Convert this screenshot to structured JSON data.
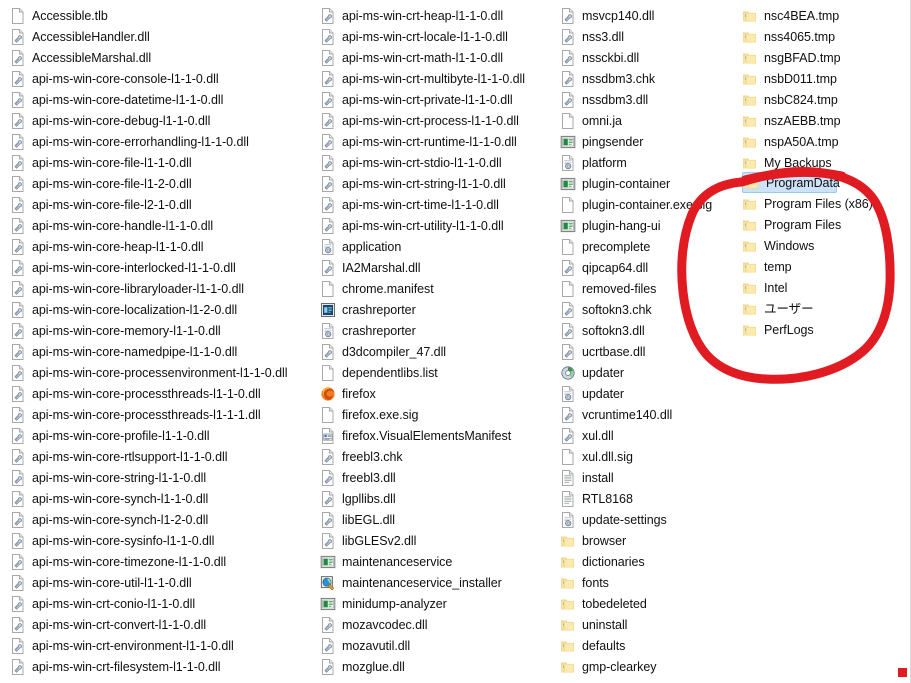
{
  "view": {
    "name": "file-list",
    "layout": "multi-column-list",
    "background": "#ffffff",
    "selection_color": "#cce3f7",
    "annotation_color": "#e01b22"
  },
  "annotation": {
    "type": "hand-drawn-circle",
    "color": "#e01b22",
    "encircles": [
      "ProgramData",
      "Program Files (x86)",
      "Program Files",
      "Windows",
      "temp",
      "Intel",
      "ユーザー",
      "PerfLogs"
    ]
  },
  "columns": [
    {
      "id": "column-1",
      "items": [
        {
          "name": "Accessible.tlb",
          "icon": "generic-file-icon",
          "type": "file"
        },
        {
          "name": "AccessibleHandler.dll",
          "icon": "dll-file-icon",
          "type": "file"
        },
        {
          "name": "AccessibleMarshal.dll",
          "icon": "dll-file-icon",
          "type": "file"
        },
        {
          "name": "api-ms-win-core-console-l1-1-0.dll",
          "icon": "dll-file-icon",
          "type": "file"
        },
        {
          "name": "api-ms-win-core-datetime-l1-1-0.dll",
          "icon": "dll-file-icon",
          "type": "file"
        },
        {
          "name": "api-ms-win-core-debug-l1-1-0.dll",
          "icon": "dll-file-icon",
          "type": "file"
        },
        {
          "name": "api-ms-win-core-errorhandling-l1-1-0.dll",
          "icon": "dll-file-icon",
          "type": "file"
        },
        {
          "name": "api-ms-win-core-file-l1-1-0.dll",
          "icon": "dll-file-icon",
          "type": "file"
        },
        {
          "name": "api-ms-win-core-file-l1-2-0.dll",
          "icon": "dll-file-icon",
          "type": "file"
        },
        {
          "name": "api-ms-win-core-file-l2-1-0.dll",
          "icon": "dll-file-icon",
          "type": "file"
        },
        {
          "name": "api-ms-win-core-handle-l1-1-0.dll",
          "icon": "dll-file-icon",
          "type": "file"
        },
        {
          "name": "api-ms-win-core-heap-l1-1-0.dll",
          "icon": "dll-file-icon",
          "type": "file"
        },
        {
          "name": "api-ms-win-core-interlocked-l1-1-0.dll",
          "icon": "dll-file-icon",
          "type": "file"
        },
        {
          "name": "api-ms-win-core-libraryloader-l1-1-0.dll",
          "icon": "dll-file-icon",
          "type": "file"
        },
        {
          "name": "api-ms-win-core-localization-l1-2-0.dll",
          "icon": "dll-file-icon",
          "type": "file"
        },
        {
          "name": "api-ms-win-core-memory-l1-1-0.dll",
          "icon": "dll-file-icon",
          "type": "file"
        },
        {
          "name": "api-ms-win-core-namedpipe-l1-1-0.dll",
          "icon": "dll-file-icon",
          "type": "file"
        },
        {
          "name": "api-ms-win-core-processenvironment-l1-1-0.dll",
          "icon": "dll-file-icon",
          "type": "file"
        },
        {
          "name": "api-ms-win-core-processthreads-l1-1-0.dll",
          "icon": "dll-file-icon",
          "type": "file"
        },
        {
          "name": "api-ms-win-core-processthreads-l1-1-1.dll",
          "icon": "dll-file-icon",
          "type": "file"
        },
        {
          "name": "api-ms-win-core-profile-l1-1-0.dll",
          "icon": "dll-file-icon",
          "type": "file"
        },
        {
          "name": "api-ms-win-core-rtlsupport-l1-1-0.dll",
          "icon": "dll-file-icon",
          "type": "file"
        },
        {
          "name": "api-ms-win-core-string-l1-1-0.dll",
          "icon": "dll-file-icon",
          "type": "file"
        },
        {
          "name": "api-ms-win-core-synch-l1-1-0.dll",
          "icon": "dll-file-icon",
          "type": "file"
        },
        {
          "name": "api-ms-win-core-synch-l1-2-0.dll",
          "icon": "dll-file-icon",
          "type": "file"
        },
        {
          "name": "api-ms-win-core-sysinfo-l1-1-0.dll",
          "icon": "dll-file-icon",
          "type": "file"
        },
        {
          "name": "api-ms-win-core-timezone-l1-1-0.dll",
          "icon": "dll-file-icon",
          "type": "file"
        },
        {
          "name": "api-ms-win-core-util-l1-1-0.dll",
          "icon": "dll-file-icon",
          "type": "file"
        },
        {
          "name": "api-ms-win-crt-conio-l1-1-0.dll",
          "icon": "dll-file-icon",
          "type": "file"
        },
        {
          "name": "api-ms-win-crt-convert-l1-1-0.dll",
          "icon": "dll-file-icon",
          "type": "file"
        },
        {
          "name": "api-ms-win-crt-environment-l1-1-0.dll",
          "icon": "dll-file-icon",
          "type": "file"
        },
        {
          "name": "api-ms-win-crt-filesystem-l1-1-0.dll",
          "icon": "dll-file-icon",
          "type": "file"
        }
      ]
    },
    {
      "id": "column-2",
      "items": [
        {
          "name": "api-ms-win-crt-heap-l1-1-0.dll",
          "icon": "dll-file-icon",
          "type": "file"
        },
        {
          "name": "api-ms-win-crt-locale-l1-1-0.dll",
          "icon": "dll-file-icon",
          "type": "file"
        },
        {
          "name": "api-ms-win-crt-math-l1-1-0.dll",
          "icon": "dll-file-icon",
          "type": "file"
        },
        {
          "name": "api-ms-win-crt-multibyte-l1-1-0.dll",
          "icon": "dll-file-icon",
          "type": "file"
        },
        {
          "name": "api-ms-win-crt-private-l1-1-0.dll",
          "icon": "dll-file-icon",
          "type": "file"
        },
        {
          "name": "api-ms-win-crt-process-l1-1-0.dll",
          "icon": "dll-file-icon",
          "type": "file"
        },
        {
          "name": "api-ms-win-crt-runtime-l1-1-0.dll",
          "icon": "dll-file-icon",
          "type": "file"
        },
        {
          "name": "api-ms-win-crt-stdio-l1-1-0.dll",
          "icon": "dll-file-icon",
          "type": "file"
        },
        {
          "name": "api-ms-win-crt-string-l1-1-0.dll",
          "icon": "dll-file-icon",
          "type": "file"
        },
        {
          "name": "api-ms-win-crt-time-l1-1-0.dll",
          "icon": "dll-file-icon",
          "type": "file"
        },
        {
          "name": "api-ms-win-crt-utility-l1-1-0.dll",
          "icon": "dll-file-icon",
          "type": "file"
        },
        {
          "name": "application",
          "icon": "config-file-icon",
          "type": "file"
        },
        {
          "name": "IA2Marshal.dll",
          "icon": "dll-file-icon",
          "type": "file"
        },
        {
          "name": "chrome.manifest",
          "icon": "generic-file-icon",
          "type": "file"
        },
        {
          "name": "crashreporter",
          "icon": "app-exe-icon",
          "type": "file"
        },
        {
          "name": "crashreporter",
          "icon": "config-file-icon",
          "type": "file"
        },
        {
          "name": "d3dcompiler_47.dll",
          "icon": "dll-file-icon",
          "type": "file"
        },
        {
          "name": "dependentlibs.list",
          "icon": "generic-file-icon",
          "type": "file"
        },
        {
          "name": "firefox",
          "icon": "firefox-icon",
          "type": "file"
        },
        {
          "name": "firefox.exe.sig",
          "icon": "generic-file-icon",
          "type": "file"
        },
        {
          "name": "firefox.VisualElementsManifest",
          "icon": "xml-file-icon",
          "type": "file"
        },
        {
          "name": "freebl3.chk",
          "icon": "dll-file-icon",
          "type": "file"
        },
        {
          "name": "freebl3.dll",
          "icon": "dll-file-icon",
          "type": "file"
        },
        {
          "name": "lgpllibs.dll",
          "icon": "dll-file-icon",
          "type": "file"
        },
        {
          "name": "libEGL.dll",
          "icon": "dll-file-icon",
          "type": "file"
        },
        {
          "name": "libGLESv2.dll",
          "icon": "dll-file-icon",
          "type": "file"
        },
        {
          "name": "maintenanceservice",
          "icon": "console-exe-icon",
          "type": "file"
        },
        {
          "name": "maintenanceservice_installer",
          "icon": "installer-icon",
          "type": "file"
        },
        {
          "name": "minidump-analyzer",
          "icon": "console-exe-icon",
          "type": "file"
        },
        {
          "name": "mozavcodec.dll",
          "icon": "dll-file-icon",
          "type": "file"
        },
        {
          "name": "mozavutil.dll",
          "icon": "dll-file-icon",
          "type": "file"
        },
        {
          "name": "mozglue.dll",
          "icon": "dll-file-icon",
          "type": "file"
        }
      ]
    },
    {
      "id": "column-3",
      "items": [
        {
          "name": "msvcp140.dll",
          "icon": "dll-file-icon",
          "type": "file"
        },
        {
          "name": "nss3.dll",
          "icon": "dll-file-icon",
          "type": "file"
        },
        {
          "name": "nssckbi.dll",
          "icon": "dll-file-icon",
          "type": "file"
        },
        {
          "name": "nssdbm3.chk",
          "icon": "dll-file-icon",
          "type": "file"
        },
        {
          "name": "nssdbm3.dll",
          "icon": "dll-file-icon",
          "type": "file"
        },
        {
          "name": "omni.ja",
          "icon": "generic-file-icon",
          "type": "file"
        },
        {
          "name": "pingsender",
          "icon": "console-exe-icon",
          "type": "file"
        },
        {
          "name": "platform",
          "icon": "config-file-icon",
          "type": "file"
        },
        {
          "name": "plugin-container",
          "icon": "console-exe-icon",
          "type": "file"
        },
        {
          "name": "plugin-container.exe.sig",
          "icon": "generic-file-icon",
          "type": "file"
        },
        {
          "name": "plugin-hang-ui",
          "icon": "console-exe-icon",
          "type": "file"
        },
        {
          "name": "precomplete",
          "icon": "generic-file-icon",
          "type": "file"
        },
        {
          "name": "qipcap64.dll",
          "icon": "dll-file-icon",
          "type": "file"
        },
        {
          "name": "removed-files",
          "icon": "generic-file-icon",
          "type": "file"
        },
        {
          "name": "softokn3.chk",
          "icon": "dll-file-icon",
          "type": "file"
        },
        {
          "name": "softokn3.dll",
          "icon": "dll-file-icon",
          "type": "file"
        },
        {
          "name": "ucrtbase.dll",
          "icon": "dll-file-icon",
          "type": "file"
        },
        {
          "name": "updater",
          "icon": "updater-app-icon",
          "type": "file"
        },
        {
          "name": "updater",
          "icon": "config-file-icon",
          "type": "file"
        },
        {
          "name": "vcruntime140.dll",
          "icon": "dll-file-icon",
          "type": "file"
        },
        {
          "name": "xul.dll",
          "icon": "dll-file-icon",
          "type": "file"
        },
        {
          "name": "xul.dll.sig",
          "icon": "generic-file-icon",
          "type": "file"
        },
        {
          "name": "install",
          "icon": "text-file-icon",
          "type": "file"
        },
        {
          "name": "RTL8168",
          "icon": "text-file-icon",
          "type": "file"
        },
        {
          "name": "update-settings",
          "icon": "config-file-icon",
          "type": "file"
        },
        {
          "name": "browser",
          "icon": "folder-icon",
          "type": "folder"
        },
        {
          "name": "dictionaries",
          "icon": "folder-icon",
          "type": "folder"
        },
        {
          "name": "fonts",
          "icon": "folder-icon",
          "type": "folder"
        },
        {
          "name": "tobedeleted",
          "icon": "folder-icon",
          "type": "folder"
        },
        {
          "name": "uninstall",
          "icon": "folder-icon",
          "type": "folder"
        },
        {
          "name": "defaults",
          "icon": "folder-icon",
          "type": "folder"
        },
        {
          "name": "gmp-clearkey",
          "icon": "folder-icon",
          "type": "folder"
        }
      ]
    },
    {
      "id": "column-4",
      "items": [
        {
          "name": "nsc4BEA.tmp",
          "icon": "folder-icon",
          "type": "folder"
        },
        {
          "name": "nss4065.tmp",
          "icon": "folder-icon",
          "type": "folder"
        },
        {
          "name": "nsgBFAD.tmp",
          "icon": "folder-icon",
          "type": "folder"
        },
        {
          "name": "nsbD011.tmp",
          "icon": "folder-icon",
          "type": "folder"
        },
        {
          "name": "nsbC824.tmp",
          "icon": "folder-icon",
          "type": "folder"
        },
        {
          "name": "nszAEBB.tmp",
          "icon": "folder-icon",
          "type": "folder"
        },
        {
          "name": "nspA50A.tmp",
          "icon": "folder-icon",
          "type": "folder"
        },
        {
          "name": "My Backups",
          "icon": "folder-icon",
          "type": "folder"
        },
        {
          "name": "ProgramData",
          "icon": "folder-icon",
          "type": "folder",
          "selected": true
        },
        {
          "name": "Program Files (x86)",
          "icon": "folder-icon",
          "type": "folder"
        },
        {
          "name": "Program Files",
          "icon": "folder-icon",
          "type": "folder"
        },
        {
          "name": "Windows",
          "icon": "folder-icon",
          "type": "folder"
        },
        {
          "name": "temp",
          "icon": "folder-icon",
          "type": "folder"
        },
        {
          "name": "Intel",
          "icon": "folder-icon",
          "type": "folder"
        },
        {
          "name": "ユーザー",
          "icon": "folder-icon",
          "type": "folder"
        },
        {
          "name": "PerfLogs",
          "icon": "folder-icon",
          "type": "folder"
        }
      ]
    }
  ]
}
